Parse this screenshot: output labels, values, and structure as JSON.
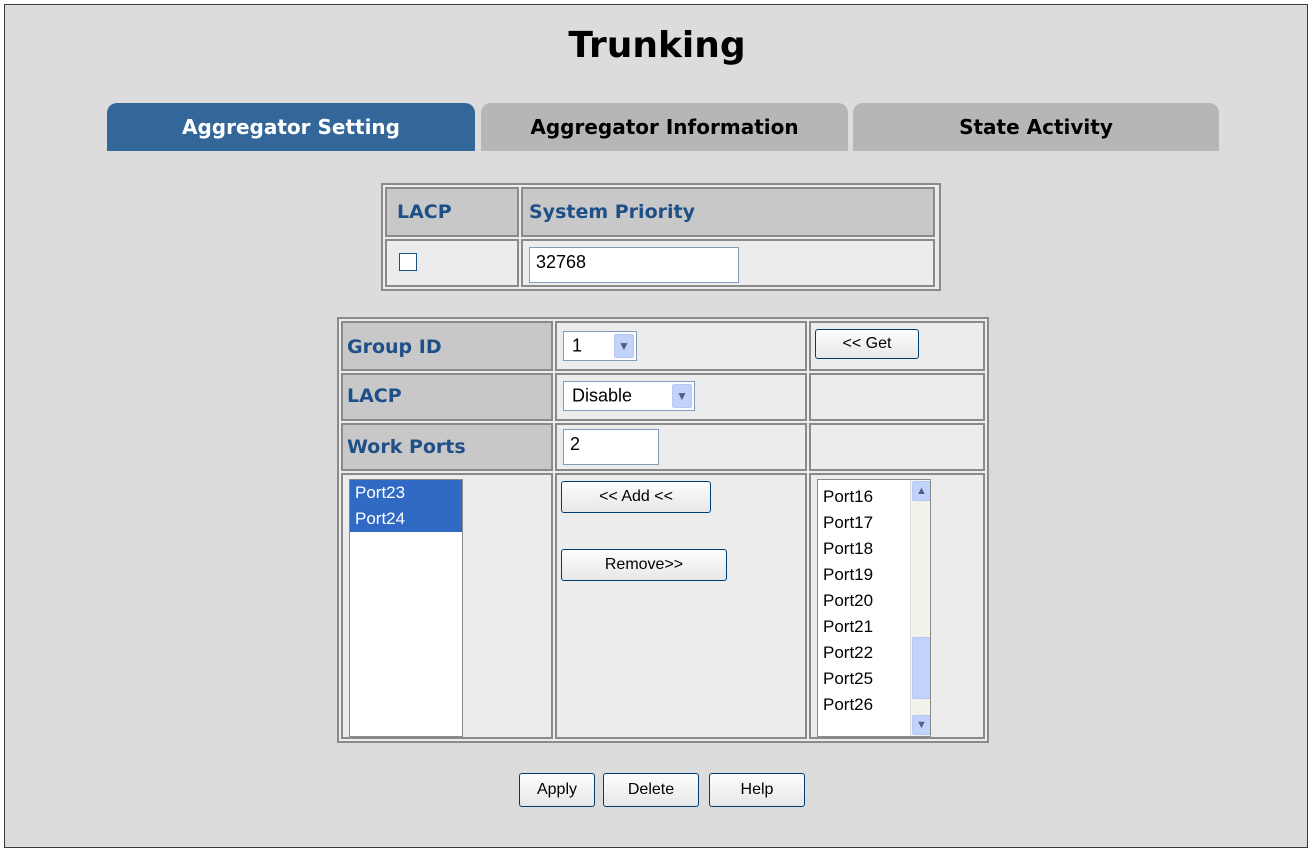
{
  "page": {
    "title": "Trunking"
  },
  "tabs": [
    {
      "label": "Aggregator Setting",
      "active": true
    },
    {
      "label": "Aggregator Information",
      "active": false
    },
    {
      "label": "State Activity",
      "active": false
    }
  ],
  "system": {
    "lacp_header": "LACP",
    "priority_header": "System Priority",
    "lacp_checked": false,
    "priority_value": "32768"
  },
  "group": {
    "group_id_label": "Group ID",
    "group_id_value": "1",
    "get_button": "<< Get",
    "lacp_label": "LACP",
    "lacp_value": "Disable",
    "work_ports_label": "Work Ports",
    "work_ports_value": "2",
    "selected_ports": [
      "Port23",
      "Port24"
    ],
    "add_button": "<< Add <<",
    "remove_button": "Remove>>",
    "available_ports": [
      "Port16",
      "Port17",
      "Port18",
      "Port19",
      "Port20",
      "Port21",
      "Port22",
      "Port25",
      "Port26"
    ]
  },
  "actions": {
    "apply": "Apply",
    "delete": "Delete",
    "help": "Help"
  },
  "colors": {
    "tab_active": "#336699",
    "tab_inactive": "#b6b6b6",
    "label": "#1f4f87",
    "selection": "#316ac5"
  }
}
